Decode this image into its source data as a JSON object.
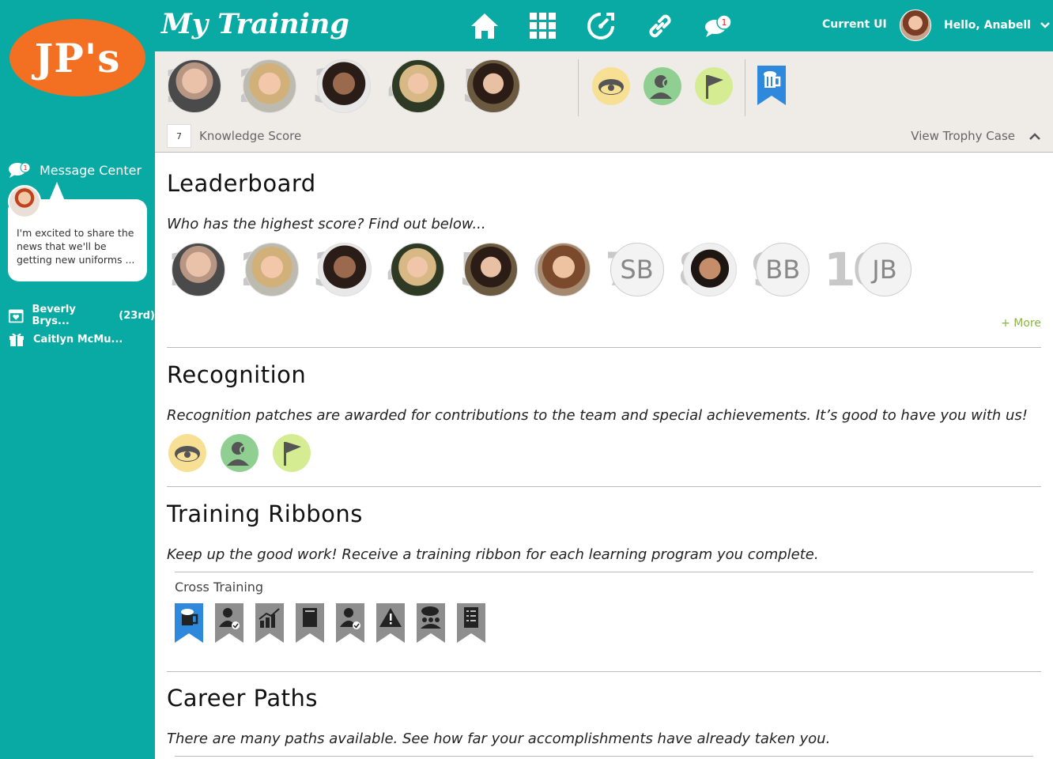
{
  "brand": {
    "logo_text": "JP's",
    "logo_color": "#f36f21",
    "accent": "#08aaa3"
  },
  "header": {
    "title": "My Training",
    "nav_icons": [
      "home-icon",
      "apps-grid-icon",
      "dashboard-icon",
      "link-icon",
      "chat-icon"
    ],
    "chat_badge": "1",
    "current_ui": "Current UI",
    "greeting": "Hello, Anabell"
  },
  "sidebar": {
    "message_center": {
      "label": "Message Center",
      "badge": "1",
      "message": "I'm excited to share the news that we'll be getting new uniforms ..."
    },
    "events": [
      {
        "icon": "calendar-heart-icon",
        "name": "Beverly Brys...",
        "detail": "(23rd)"
      },
      {
        "icon": "gift-icon",
        "name": "Caitlyn McMu...",
        "detail": ""
      }
    ]
  },
  "trophy": {
    "top_ranks": [
      "1",
      "2",
      "3",
      "4",
      "5"
    ],
    "knowledge_score_value": "7",
    "knowledge_score_label": "Knowledge Score",
    "view_trophy_case": "View Trophy Case"
  },
  "leaderboard": {
    "title": "Leaderboard",
    "subtitle": "Who has the highest score? Find out below...",
    "ranks": [
      {
        "num": "1",
        "initials": ""
      },
      {
        "num": "2",
        "initials": ""
      },
      {
        "num": "3",
        "initials": ""
      },
      {
        "num": "4",
        "initials": ""
      },
      {
        "num": "5",
        "initials": ""
      },
      {
        "num": "6",
        "initials": ""
      },
      {
        "num": "7",
        "initials": "SB"
      },
      {
        "num": "8",
        "initials": ""
      },
      {
        "num": "9",
        "initials": "BB"
      },
      {
        "num": "10",
        "initials": "JB"
      }
    ],
    "more": "+ More"
  },
  "recognition": {
    "title": "Recognition",
    "subtitle": "Recognition patches are awarded for contributions to the team and special achievements. It’s good to have you with us!"
  },
  "training_ribbons": {
    "title": "Training Ribbons",
    "subtitle": "Keep up the good work! Receive a training ribbon for each learning program you complete.",
    "program": "Cross Training",
    "ribbons": [
      "beer-mug-icon",
      "user-check-icon",
      "chart-icon",
      "menu-book-icon",
      "user-check-icon",
      "warning-icon",
      "team-chat-icon",
      "checklist-icon"
    ]
  },
  "career_paths": {
    "title": "Career Paths",
    "subtitle": "There are many paths available. See how far your accomplishments have already taken you."
  }
}
